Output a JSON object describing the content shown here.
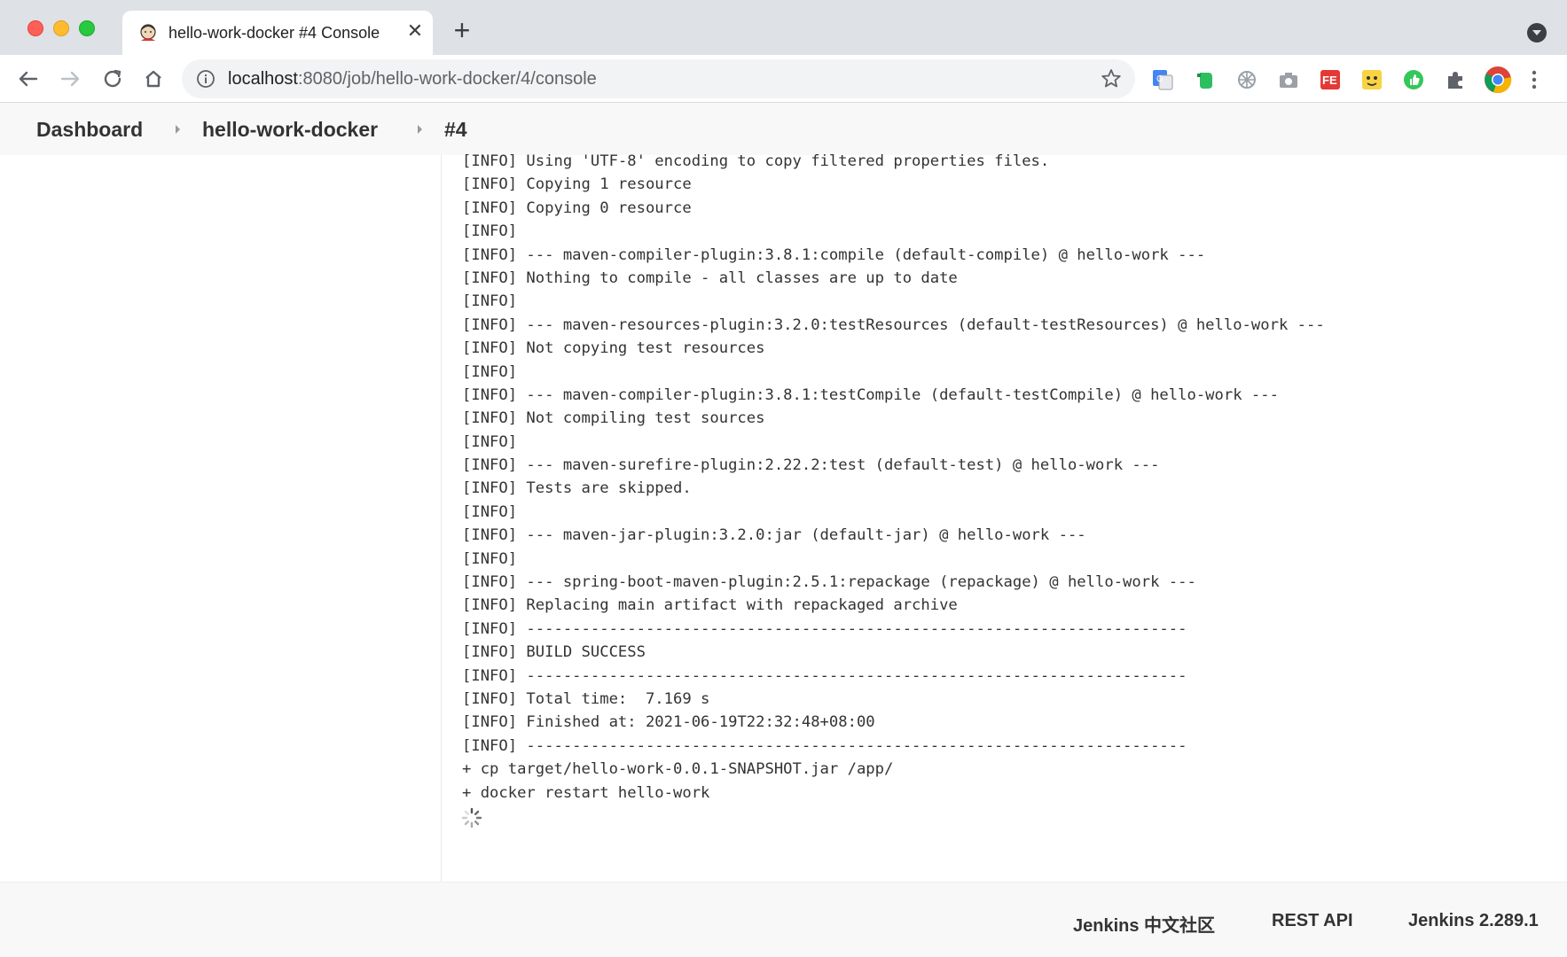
{
  "tab": {
    "title": "hello-work-docker #4 Console",
    "close": "✕",
    "new": "+"
  },
  "toolbar": {
    "url_host": "localhost",
    "url_rest": ":8080/job/hello-work-docker/4/console",
    "extensions": [
      "google-translate",
      "evernote",
      "perplexity",
      "screenshot",
      "fe-helper",
      "cat",
      "thumb-up",
      "extensions-puzzle",
      "chrome"
    ]
  },
  "breadcrumb": {
    "items": [
      "Dashboard",
      "hello-work-docker",
      "#4"
    ]
  },
  "console": {
    "lines": [
      "[INFO] Using 'UTF-8' encoding to copy filtered properties files.",
      "[INFO] Copying 1 resource",
      "[INFO] Copying 0 resource",
      "[INFO]",
      "[INFO] --- maven-compiler-plugin:3.8.1:compile (default-compile) @ hello-work ---",
      "[INFO] Nothing to compile - all classes are up to date",
      "[INFO]",
      "[INFO] --- maven-resources-plugin:3.2.0:testResources (default-testResources) @ hello-work ---",
      "[INFO] Not copying test resources",
      "[INFO]",
      "[INFO] --- maven-compiler-plugin:3.8.1:testCompile (default-testCompile) @ hello-work ---",
      "[INFO] Not compiling test sources",
      "[INFO]",
      "[INFO] --- maven-surefire-plugin:2.22.2:test (default-test) @ hello-work ---",
      "[INFO] Tests are skipped.",
      "[INFO]",
      "[INFO] --- maven-jar-plugin:3.2.0:jar (default-jar) @ hello-work ---",
      "[INFO]",
      "[INFO] --- spring-boot-maven-plugin:2.5.1:repackage (repackage) @ hello-work ---",
      "[INFO] Replacing main artifact with repackaged archive",
      "[INFO] ------------------------------------------------------------------------",
      "[INFO] BUILD SUCCESS",
      "[INFO] ------------------------------------------------------------------------",
      "[INFO] Total time:  7.169 s",
      "[INFO] Finished at: 2021-06-19T22:32:48+08:00",
      "[INFO] ------------------------------------------------------------------------",
      "+ cp target/hello-work-0.0.1-SNAPSHOT.jar /app/",
      "+ docker restart hello-work"
    ]
  },
  "footer": {
    "community": "Jenkins 中文社区",
    "rest_api": "REST API",
    "version": "Jenkins 2.289.1"
  }
}
